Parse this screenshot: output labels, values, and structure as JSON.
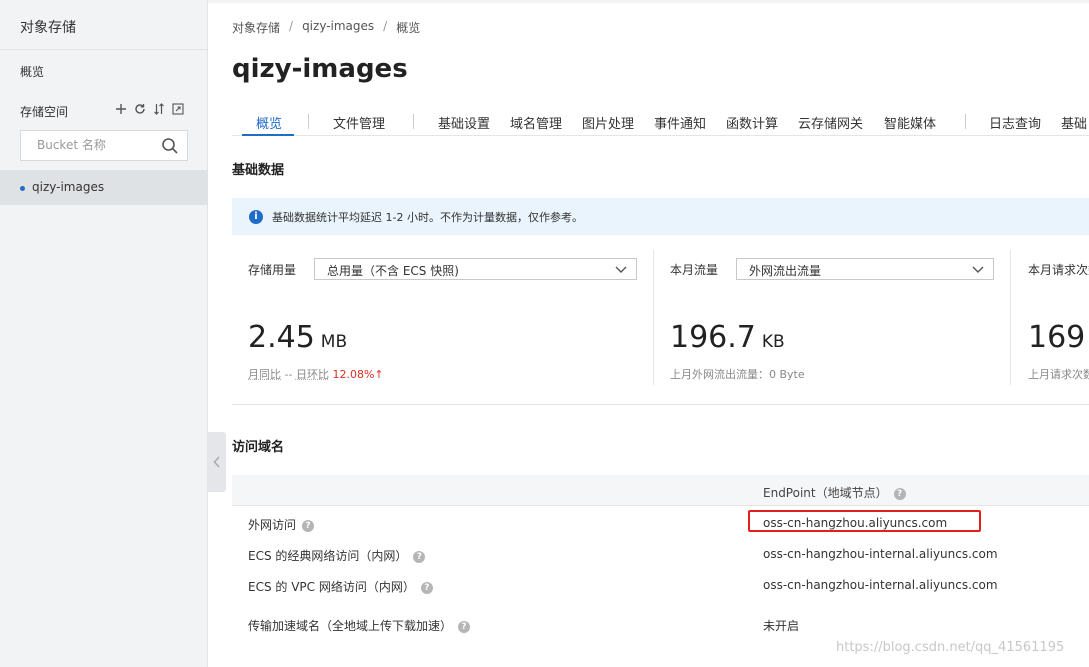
{
  "sidebar": {
    "title": "对象存储",
    "overview": "概览",
    "storage_space": "存储空间",
    "tools": [
      "plus-icon",
      "refresh-icon",
      "sort-icon",
      "expand-icon"
    ],
    "search_placeholder": "Bucket 名称",
    "buckets": [
      {
        "name": "qizy-images",
        "selected": true
      }
    ]
  },
  "breadcrumb": [
    "对象存储",
    "qizy-images",
    "概览"
  ],
  "page_title": "qizy-images",
  "tabs": [
    "概览",
    "文件管理",
    "基础设置",
    "域名管理",
    "图片处理",
    "事件通知",
    "函数计算",
    "云存储网关",
    "智能媒体",
    "日志查询",
    "基础"
  ],
  "active_tab": 0,
  "basic_data": {
    "title": "基础数据",
    "notice": "基础数据统计平均延迟 1-2 小时。不作为计量数据，仅作参考。",
    "cards": [
      {
        "label": "存储用量",
        "select": "总用量（不含 ECS 快照)",
        "value": "2.45",
        "unit": "MB",
        "sub": {
          "mom_label": "月同比",
          "mom_value": "--",
          "dod_label": "日环比",
          "dod_value": "12.08%",
          "dod_arrow": "↑"
        }
      },
      {
        "label": "本月流量",
        "select": "外网流出流量",
        "value": "196.7",
        "unit": "KB",
        "sub_text": "上月外网流出流量：0 Byte"
      },
      {
        "label": "本月请求次数",
        "value": "169",
        "sub_text": "上月请求次数"
      }
    ]
  },
  "access_domain": {
    "title": "访问域名",
    "column_header": "EndPoint（地域节点）",
    "rows": [
      {
        "label": "外网访问",
        "endpoint": "oss-cn-hangzhou.aliyuncs.com",
        "highlighted": true
      },
      {
        "label": "ECS 的经典网络访问（内网）",
        "endpoint": "oss-cn-hangzhou-internal.aliyuncs.com"
      },
      {
        "label": "ECS 的 VPC 网络访问（内网）",
        "endpoint": "oss-cn-hangzhou-internal.aliyuncs.com"
      },
      {
        "label": "传输加速域名（全地域上传下载加速）",
        "endpoint": "未开启"
      }
    ]
  },
  "watermark": "https://blog.csdn.net/qq_41561195",
  "colors": {
    "accent": "#ff6a00",
    "link": "#1f6cc9",
    "up": "#d93026",
    "highlight": "#e01f1f"
  }
}
